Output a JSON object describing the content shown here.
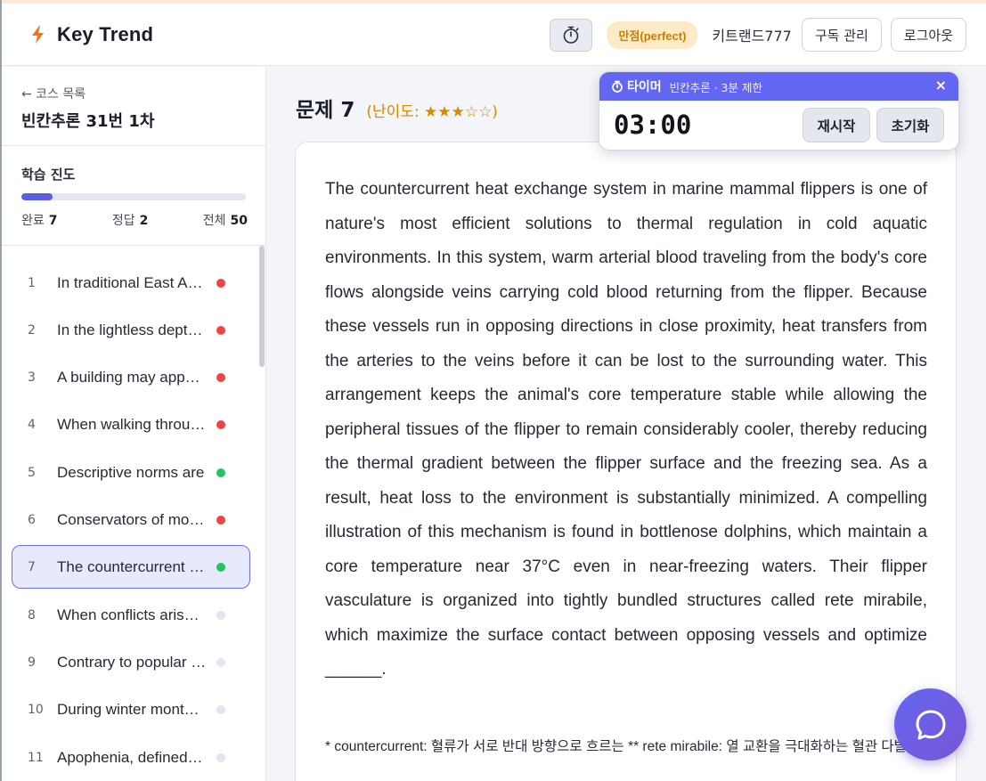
{
  "header": {
    "app_name": "Key Trend",
    "badge": "만점(perfect)",
    "username": "키트랜드777",
    "subscription_button": "구독 관리",
    "logout_button": "로그아웃"
  },
  "sidebar": {
    "back_link": "← 코스 목록",
    "course_title": "빈칸추론 31번 1차",
    "progress_title": "학습 진도",
    "progress_fraction": 0.14,
    "stats": {
      "completed_label": "완료",
      "completed_value": "7",
      "correct_label": "정답",
      "correct_value": "2",
      "total_label": "전체",
      "total_value": "50"
    },
    "questions": [
      {
        "num": "1",
        "text": "In traditional East Asian art, the concept",
        "status": "wrong"
      },
      {
        "num": "2",
        "text": "In the lightless depths of the ocean",
        "status": "wrong"
      },
      {
        "num": "3",
        "text": "A building may appear to be",
        "status": "wrong"
      },
      {
        "num": "4",
        "text": "When walking through a forest",
        "status": "wrong"
      },
      {
        "num": "5",
        "text": "Descriptive norms are",
        "status": "correct"
      },
      {
        "num": "6",
        "text": "Conservators of modern art",
        "status": "wrong"
      },
      {
        "num": "7",
        "text": "The countercurrent heat exchange",
        "status": "correct",
        "active": true
      },
      {
        "num": "8",
        "text": "When conflicts arise between",
        "status": "unanswered"
      },
      {
        "num": "9",
        "text": "Contrary to popular belief",
        "status": "unanswered"
      },
      {
        "num": "10",
        "text": "During winter months, many",
        "status": "unanswered"
      },
      {
        "num": "11",
        "text": "Apophenia, defined as the",
        "status": "unanswered"
      }
    ],
    "status_colors": {
      "wrong": "#ef4444",
      "correct": "#22c55e",
      "unanswered": "#e2e6ee"
    }
  },
  "question": {
    "title": "문제 7",
    "difficulty": "(난이도: ★★★☆☆)",
    "passage": "The countercurrent heat exchange system in marine mammal flippers is one of nature's most efficient solutions to thermal regulation in cold aquatic environments. In this system, warm arterial blood traveling from the body's core flows alongside veins carrying cold blood returning from the flipper. Because these vessels run in opposing directions in close proximity, heat transfers from the arteries to the veins before it can be lost to the surrounding water. This arrangement keeps the animal's core temperature stable while allowing the peripheral tissues of the flipper to remain considerably cooler, thereby reducing the thermal gradient between the flipper surface and the freezing sea. As a result, heat loss to the environment is substantially minimized. A compelling illustration of this mechanism is found in bottlenose dolphins, which maintain a core temperature near 37°C even in near-freezing waters. Their flipper vasculature is organized into tightly bundled structures called rete mirabile, which maximize the surface contact between opposing vessels and optimize ______.",
    "footnote": "* countercurrent: 혈류가 서로 반대 방향으로 흐르는   ** rete mirabile: 열 교환을 극대화하는 혈관 다발 구조"
  },
  "timer": {
    "title": "타이머",
    "subtitle": "빈칸추론 · 3분 제한",
    "time": "03:00",
    "restart_button": "재시작",
    "reset_button": "초기화",
    "close": "×"
  },
  "colors": {
    "accent": "#6366f1",
    "badge_text": "#c77d00",
    "difficulty": "#d58a00"
  },
  "icons": {
    "logo": "lightning-bolt-icon",
    "timer": "stopwatch-icon",
    "chat": "chat-bubble-icon"
  }
}
